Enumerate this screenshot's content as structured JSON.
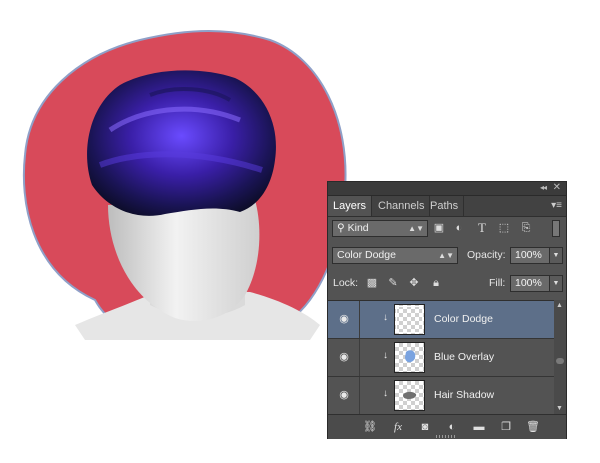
{
  "panel": {
    "tabs": [
      "Layers",
      "Channels",
      "Paths"
    ],
    "active_tab": "Layers",
    "filter": {
      "value": "Kind"
    },
    "blend_mode": "Color Dodge",
    "opacity_label": "Opacity:",
    "opacity_value": "100%",
    "lock_label": "Lock:",
    "fill_label": "Fill:",
    "fill_value": "100%",
    "layers": [
      {
        "name": "Color Dodge",
        "selected": true,
        "clipped": true,
        "visible": true
      },
      {
        "name": "Blue Overlay",
        "selected": false,
        "clipped": true,
        "visible": true
      },
      {
        "name": "Hair Shadow",
        "selected": false,
        "clipped": true,
        "visible": true
      }
    ]
  },
  "colors": {
    "canvas_red": "#d84a5a",
    "hair_purple": "#4b2bb8",
    "panel_bg": "#535353",
    "selected_row": "#5d6f89"
  },
  "icons": {
    "filter_icons": [
      "image-filter-icon",
      "adjustment-filter-icon",
      "type-filter-icon",
      "shape-filter-icon",
      "smart-object-filter-icon"
    ],
    "lock_icons": [
      "lock-transparent-icon",
      "lock-image-icon",
      "lock-position-icon",
      "lock-all-icon"
    ],
    "footer_icons": [
      "link-icon",
      "fx-icon",
      "mask-icon",
      "adjustment-layer-icon",
      "group-folder-icon",
      "new-layer-icon",
      "trash-icon"
    ]
  }
}
